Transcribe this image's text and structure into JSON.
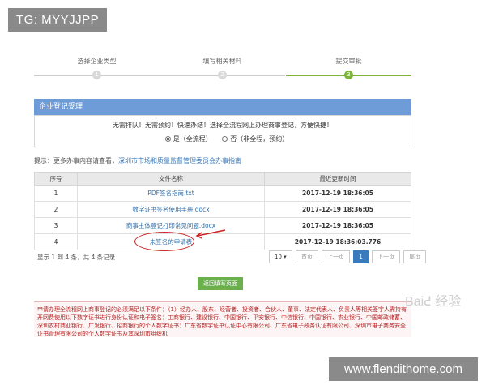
{
  "overlay": {
    "tag": "TG: MYYJJPP",
    "site": "www.flendithome.com",
    "watermark": "Baiᕍ 经验"
  },
  "steps": [
    {
      "label": "选择企业类型",
      "num": "1"
    },
    {
      "label": "填写相关材料",
      "num": "2"
    },
    {
      "label": "提交审批",
      "num": "3"
    }
  ],
  "panel": {
    "title": "企业登记受理",
    "notice": "无需排队！无需预约！快速办结！选择全流程网上办理商事登记，方便快捷！",
    "option_yes": "是（全流程）",
    "option_no": "否（非全程，预约）"
  },
  "tip": {
    "prefix": "提示：更多办事内容请查看，",
    "link": "深圳市市场和质量监督管理委员会办事指南"
  },
  "table": {
    "headers": [
      "序号",
      "文件名称",
      "最近更新时间"
    ],
    "rows": [
      {
        "no": "1",
        "name": "PDF签名指南.txt",
        "date": "2017-12-19 18:36:05"
      },
      {
        "no": "2",
        "name": "数字证书签名使用手册.docx",
        "date": "2017-12-19 18:36:05"
      },
      {
        "no": "3",
        "name": "商事主体登记打印常见问题.docx",
        "date": "2017-12-19 18:36:05"
      },
      {
        "no": "4",
        "name": "未签名的申请表",
        "date": "2017-12-19 18:36:03.776"
      }
    ]
  },
  "pager": {
    "info": "显示 1 到 4 条，共 4 条记录",
    "size": "10 ▾",
    "first": "首页",
    "prev": "上一页",
    "cur": "1",
    "next": "下一页",
    "last": "尾页"
  },
  "back_button": "返回填写页面",
  "requirements": "申请办理全流程网上商事登记的必须满足以下条件：（1）经办人、股东、经营者、投资者、合伙人、董事、法定代表人、负责人等相关签字人需持有开网费使用以下数字证书进行身份认证和电子签名：工商银行、建设银行、中国银行、平安银行、中信银行、中国银行、农业银行、中国邮政储蓄、深圳农村商业银行、广发银行、招商银行的个人数字证书：广东省数字证书认证中心有限公司、广东省电子政务认证有限公司、深圳市电子商务安全证书管理有限公司的个人数字证书及其深圳市组织机"
}
